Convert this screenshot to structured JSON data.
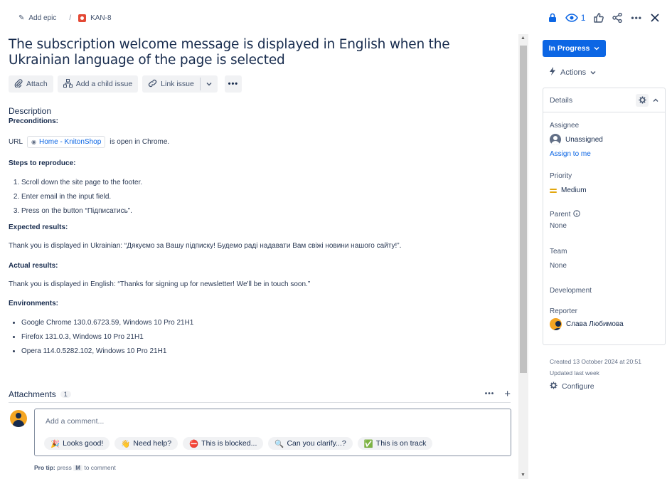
{
  "breadcrumb": {
    "epic_label": "Add epic",
    "separator": "/",
    "issue_key": "KAN-8"
  },
  "top_actions": {
    "watch_count": "1"
  },
  "issue": {
    "title": "The subscription welcome message is displayed in English when the Ukrainian language of the page is selected"
  },
  "toolbar": {
    "attach": "Attach",
    "add_child": "Add a child issue",
    "link_issue": "Link issue"
  },
  "description": {
    "heading": "Description",
    "preconditions_label": "Preconditions:",
    "url_prefix": "URL",
    "url_link": "Home - KnitonShop",
    "url_suffix": "is open in Chrome.",
    "steps_label": "Steps to reproduce:",
    "steps": [
      "Scroll down the site page to the footer.",
      "Enter email in the input field.",
      "Press on the button “Підписатись”."
    ],
    "expected_label": "Expected results:",
    "expected_text": "Thank you is displayed in Ukrainian: “Дякуємо за Вашу підписку! Будемо раді надавати Вам свіжі новини нашого сайту!”.",
    "actual_label": "Actual results:",
    "actual_text": "Thank you is displayed in English: “Thanks for signing up for newsletter! We'll be in touch soon.”",
    "env_label": "Environments:",
    "environments": [
      "Google Chrome 130.0.6723.59, Windows 10 Pro 21H1",
      "Firefox 131.0.3, Windows 10 Pro 21H1",
      "Opera 114.0.5282.102, Windows 10 Pro 21H1"
    ]
  },
  "attachments": {
    "label": "Attachments",
    "count": "1"
  },
  "comment": {
    "placeholder": "Add a comment...",
    "quick_replies": [
      {
        "emoji": "🎉",
        "label": "Looks good!"
      },
      {
        "emoji": "👋",
        "label": "Need help?"
      },
      {
        "emoji": "⛔",
        "label": "This is blocked..."
      },
      {
        "emoji": "🔍",
        "label": "Can you clarify...?"
      },
      {
        "emoji": "✅",
        "label": "This is on track"
      }
    ],
    "protip_label": "Pro tip:",
    "protip_press": "press",
    "protip_key": "M",
    "protip_suffix": "to comment"
  },
  "sidebar": {
    "status": "In Progress",
    "actions": "Actions",
    "details_title": "Details",
    "assignee_label": "Assignee",
    "assignee_value": "Unassigned",
    "assign_to_me": "Assign to me",
    "priority_label": "Priority",
    "priority_value": "Medium",
    "parent_label": "Parent",
    "parent_value": "None",
    "team_label": "Team",
    "team_value": "None",
    "development_label": "Development",
    "reporter_label": "Reporter",
    "reporter_value": "Слава Любимова",
    "created": "Created 13 October 2024 at 20:51",
    "updated": "Updated last week",
    "configure": "Configure"
  },
  "colors": {
    "accent": "#0c66e4",
    "priority_medium": "#e2a70f",
    "issue_type_red": "#e34935"
  }
}
